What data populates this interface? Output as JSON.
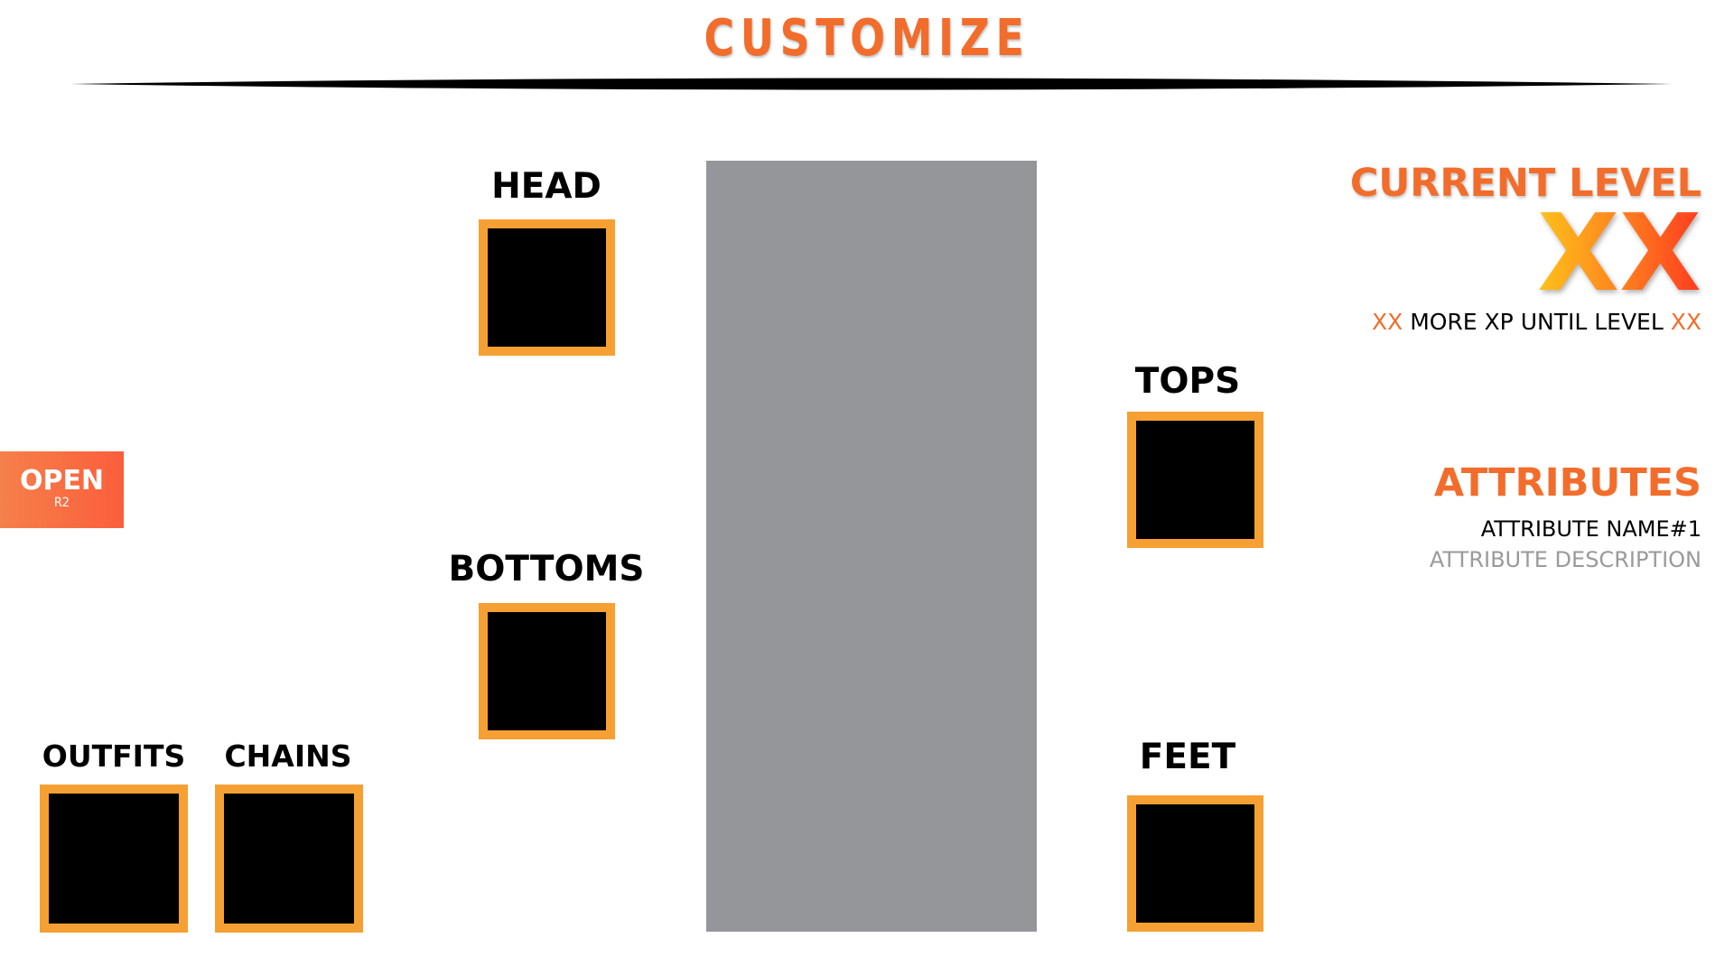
{
  "header": {
    "title": "CUSTOMIZE"
  },
  "slots": {
    "head": {
      "label": "HEAD"
    },
    "bottoms": {
      "label": "BOTTOMS"
    },
    "tops": {
      "label": "TOPS"
    },
    "feet": {
      "label": "FEET"
    },
    "outfits": {
      "label": "OUTFITS"
    },
    "chains": {
      "label": "CHAINS"
    }
  },
  "open_button": {
    "label": "OPEN",
    "key_hint": "R2"
  },
  "level": {
    "label": "CURRENT LEVEL",
    "value": "XX",
    "xp_remaining": "XX",
    "xp_text": "MORE XP UNTIL LEVEL",
    "next_level": "XX"
  },
  "attributes": {
    "label": "ATTRIBUTES",
    "name": "ATTRIBUTE NAME#1",
    "description": "ATTRIBUTE DESCRIPTION"
  },
  "colors": {
    "accent": "#f26d2b",
    "slot_border": "#f6a033",
    "slot_fill": "#000000",
    "preview_fill": "#95969a"
  },
  "icons": {
    "divider": "brush-stroke-line"
  }
}
